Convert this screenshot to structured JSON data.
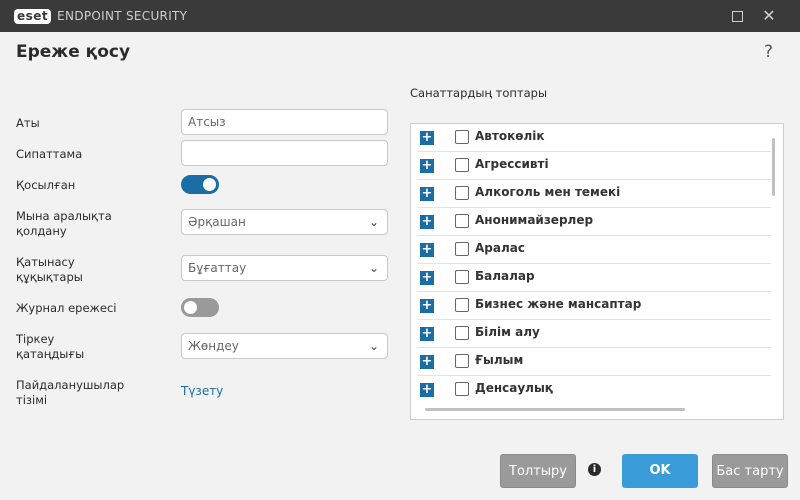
{
  "window": {
    "brand": "eset",
    "product": "ENDPOINT SECURITY",
    "maximize_icon": "maximize-icon",
    "close_icon": "close-icon",
    "close_glyph": "✕"
  },
  "page": {
    "title": "Ереже қосу",
    "help_glyph": "?"
  },
  "form": {
    "name_label": "Аты",
    "name_placeholder": "Атсыз",
    "description_label": "Сипаттама",
    "description_value": "",
    "enabled_label": "Қосылған",
    "enabled_on": true,
    "apply_interval_label": "Мына аралықта қолдану",
    "apply_interval_value": "Әрқашан",
    "access_rights_label": "Қатынасу құқықтары",
    "access_rights_value": "Бұғаттау",
    "log_rule_label": "Журнал ережесі",
    "log_rule_on": false,
    "log_severity_label": "Тіркеу қатаңдығы",
    "log_severity_value": "Жөндеу",
    "user_list_label": "Пайдаланушылар тізімі",
    "user_list_link": "Түзету",
    "chevron": "⌄"
  },
  "categories": {
    "title": "Санаттардың топтары",
    "plus_glyph": "+",
    "items": [
      "Автокөлік",
      "Агрессивті",
      "Алкоголь мен темекі",
      "Анонимайзерлер",
      "Аралас",
      "Балалар",
      "Бизнес және мансаптар",
      "Білім алу",
      "Ғылым",
      "Денсаулық"
    ]
  },
  "footer": {
    "fill_label": "Толтыру",
    "info_glyph": "i",
    "ok_label": "OK",
    "cancel_label": "Бас тарту"
  },
  "colors": {
    "accent": "#1a6ea5",
    "ok_button": "#3a9bd9",
    "titlebar": "#3a3a3a"
  }
}
